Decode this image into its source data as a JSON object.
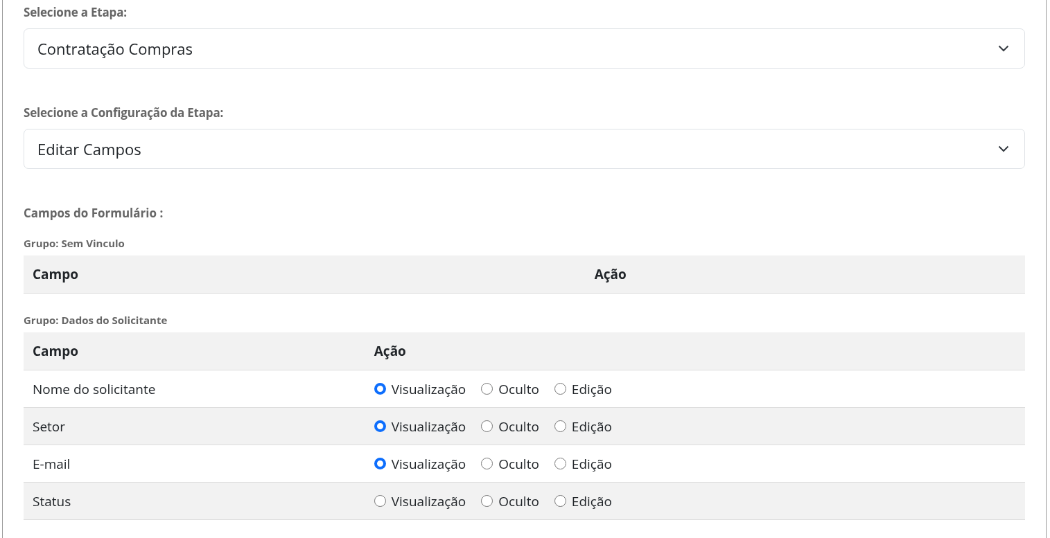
{
  "selects": [
    {
      "label": "Selecione a Etapa:",
      "value": "Contratação Compras"
    },
    {
      "label": "Selecione a Configuração da Etapa:",
      "value": "Editar Campos"
    }
  ],
  "form_fields": {
    "title": "Campos do Formulário :",
    "groups": [
      {
        "title": "Grupo: Sem Vinculo",
        "columns": [
          "Campo",
          "Ação"
        ]
      },
      {
        "title": "Grupo: Dados do Solicitante",
        "columns": [
          "Campo",
          "Ação"
        ],
        "rows": [
          {
            "field": "Nome do solicitante",
            "options": [
              {
                "label": "Visualização",
                "selected": true
              },
              {
                "label": "Oculto",
                "selected": false
              },
              {
                "label": "Edição",
                "selected": false
              }
            ]
          },
          {
            "field": "Setor",
            "options": [
              {
                "label": "Visualização",
                "selected": true
              },
              {
                "label": "Oculto",
                "selected": false
              },
              {
                "label": "Edição",
                "selected": false
              }
            ]
          },
          {
            "field": "E-mail",
            "options": [
              {
                "label": "Visualização",
                "selected": true
              },
              {
                "label": "Oculto",
                "selected": false
              },
              {
                "label": "Edição",
                "selected": false
              }
            ]
          },
          {
            "field": "Status",
            "options": [
              {
                "label": "Visualização",
                "selected": false
              },
              {
                "label": "Oculto",
                "selected": false
              },
              {
                "label": "Edição",
                "selected": false
              }
            ]
          }
        ]
      }
    ]
  }
}
